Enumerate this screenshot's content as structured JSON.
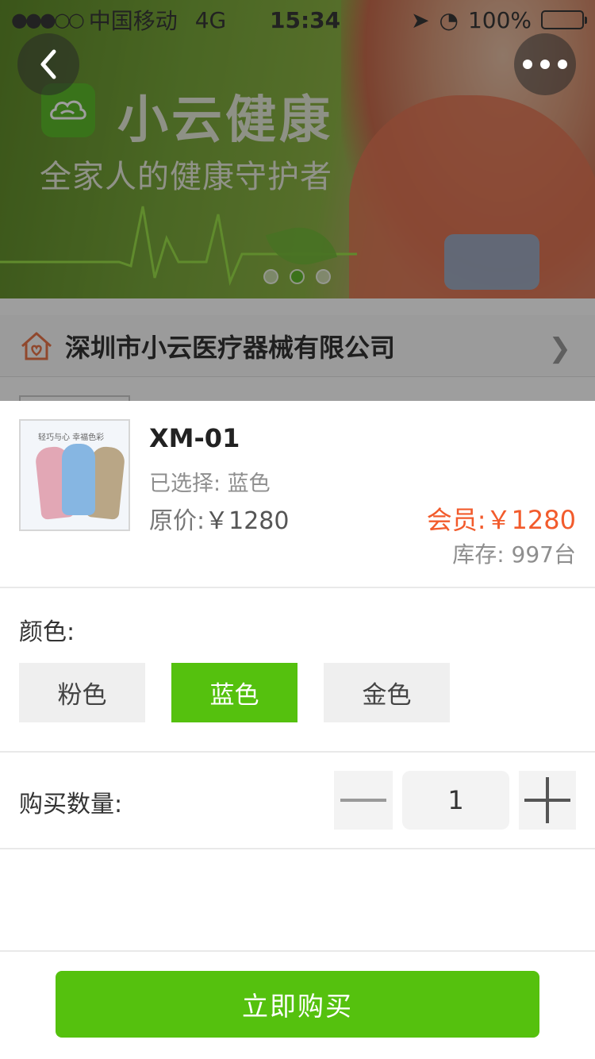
{
  "status_bar": {
    "signal": "●●●○○",
    "carrier": "中国移动",
    "network": "4G",
    "time": "15:34",
    "battery": "100%"
  },
  "banner": {
    "brand_name": "小云健康",
    "slogan": "全家人的健康守护者",
    "slide_count": 3,
    "active_slide": 2
  },
  "company": {
    "name": "深圳市小云医疗器械有限公司"
  },
  "product": {
    "thumb_tagline": "轻巧与心 幸福色彩",
    "model": "XM-01",
    "selected_label": "已选择: 蓝色",
    "original_price_label": "原价:",
    "original_price": "￥1280",
    "member_price": "会员:￥1280",
    "stock": "库存:  997台"
  },
  "color": {
    "label": "颜色:",
    "options": [
      "粉色",
      "蓝色",
      "金色"
    ],
    "selected": "蓝色"
  },
  "quantity": {
    "label": "购买数量:",
    "value": "1"
  },
  "actions": {
    "buy_now": "立即购买"
  },
  "colors": {
    "accent_green": "#55c10e",
    "member_price": "#f25b2c"
  }
}
